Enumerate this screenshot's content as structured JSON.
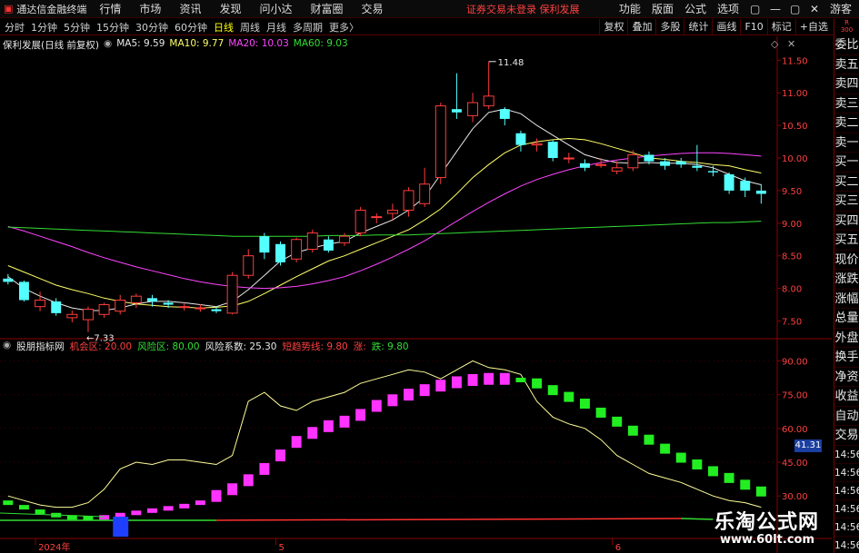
{
  "menubar": {
    "app_title": "通达信金融终端",
    "menu": [
      "行情",
      "市场",
      "资讯",
      "发现",
      "问小达",
      "财富圈",
      "交易"
    ],
    "notice": "证券交易未登录  保利发展",
    "right_menu": [
      "功能",
      "版面",
      "公式",
      "选项"
    ],
    "window_controls": [
      "▢",
      "—",
      "▢",
      "✕"
    ],
    "guest": "游客"
  },
  "periodbar": {
    "periods": [
      "分时",
      "1分钟",
      "5分钟",
      "15分钟",
      "30分钟",
      "60分钟",
      "日线",
      "周线",
      "月线",
      "多周期",
      "更多〉"
    ],
    "active": "日线",
    "tools": [
      "复权",
      "叠加",
      "多股",
      "统计",
      "画线",
      "F10",
      "标记",
      "+自选"
    ]
  },
  "main_chart": {
    "title": "保利发展(日线 前复权)",
    "ma_labels": [
      {
        "text": "MA5: 9.59",
        "color": "#e8e8e8"
      },
      {
        "text": "MA10: 9.77",
        "color": "#ffff66"
      },
      {
        "text": "MA20: 10.03",
        "color": "#ff44ff"
      },
      {
        "text": "MA60: 9.03",
        "color": "#33dd33"
      }
    ],
    "high_label": "11.48",
    "low_label": "7.33",
    "y_ticks": [
      "11.50",
      "11.00",
      "10.50",
      "10.00",
      "9.50",
      "9.00",
      "8.50",
      "8.00",
      "7.50"
    ]
  },
  "indicator": {
    "name": "股朋指标网",
    "params": [
      {
        "text": "机会区: 20.00",
        "color": "#ff4040"
      },
      {
        "text": "风险区: 80.00",
        "color": "#33dd33"
      },
      {
        "text": "风险系数: 25.30",
        "color": "#e8e8e8"
      },
      {
        "text": "短趋势线: 9.80",
        "color": "#ff4040"
      },
      {
        "text": "涨:",
        "color": "#ff4040"
      },
      {
        "text": "跌: 9.80",
        "color": "#33dd33"
      }
    ],
    "y_ticks": [
      "90.00",
      "75.00",
      "60.00",
      "45.00",
      "30.00"
    ],
    "last_value": "41.31"
  },
  "x_axis": [
    "2024年",
    "5",
    "6"
  ],
  "right_panel": {
    "top": "R\n300",
    "items": [
      "委比",
      "卖五",
      "卖四",
      "卖三",
      "卖二",
      "卖一",
      "买一",
      "买二",
      "买三",
      "买四",
      "买五",
      "现价",
      "涨跌",
      "涨幅",
      "总量",
      "外盘",
      "换手",
      "净资",
      "收益",
      "自动",
      "交易"
    ],
    "times": [
      "14:56",
      "14:56",
      "14:56",
      "14:56",
      "14:56",
      "14:56",
      "14:56"
    ]
  },
  "watermark": {
    "line1": "乐淘公式网",
    "line2": "www.60lt.com"
  },
  "chart_data": [
    {
      "type": "candlestick",
      "title": "保利发展(日线 前复权)",
      "ylim": [
        7.2,
        11.7
      ],
      "candles": [
        [
          8.15,
          8.1,
          8.22,
          8.06
        ],
        [
          8.1,
          7.82,
          8.12,
          7.8
        ],
        [
          7.72,
          7.82,
          7.95,
          7.65
        ],
        [
          7.8,
          7.62,
          7.85,
          7.58
        ],
        [
          7.55,
          7.6,
          7.66,
          7.48
        ],
        [
          7.52,
          7.68,
          7.72,
          7.33
        ],
        [
          7.6,
          7.75,
          7.78,
          7.55
        ],
        [
          7.65,
          7.82,
          7.9,
          7.6
        ],
        [
          7.78,
          7.88,
          7.92,
          7.7
        ],
        [
          7.85,
          7.8,
          7.9,
          7.72
        ],
        [
          7.78,
          7.75,
          7.82,
          7.7
        ],
        [
          7.72,
          7.72,
          7.78,
          7.66
        ],
        [
          7.7,
          7.7,
          7.76,
          7.64
        ],
        [
          7.68,
          7.65,
          7.72,
          7.62
        ],
        [
          7.62,
          8.2,
          8.25,
          7.6
        ],
        [
          8.2,
          8.5,
          8.6,
          8.15
        ],
        [
          8.8,
          8.55,
          8.85,
          8.45
        ],
        [
          8.68,
          8.4,
          8.72,
          8.35
        ],
        [
          8.45,
          8.75,
          8.78,
          8.4
        ],
        [
          8.6,
          8.85,
          8.9,
          8.55
        ],
        [
          8.75,
          8.58,
          8.8,
          8.55
        ],
        [
          8.7,
          8.8,
          8.85,
          8.65
        ],
        [
          8.85,
          9.2,
          9.25,
          8.8
        ],
        [
          9.1,
          9.1,
          9.15,
          9.0
        ],
        [
          9.15,
          9.2,
          9.3,
          9.05
        ],
        [
          9.2,
          9.5,
          9.55,
          9.1
        ],
        [
          9.3,
          9.6,
          9.85,
          9.25
        ],
        [
          9.7,
          10.8,
          10.85,
          9.6
        ],
        [
          10.75,
          10.7,
          11.3,
          10.6
        ],
        [
          10.65,
          10.85,
          11.0,
          10.55
        ],
        [
          10.8,
          10.95,
          11.48,
          10.75
        ],
        [
          10.75,
          10.6,
          10.78,
          10.5
        ],
        [
          10.38,
          10.2,
          10.42,
          10.1
        ],
        [
          10.2,
          10.22,
          10.3,
          10.1
        ],
        [
          10.25,
          10.0,
          10.28,
          9.95
        ],
        [
          10.0,
          10.0,
          10.08,
          9.92
        ],
        [
          9.92,
          9.85,
          9.98,
          9.8
        ],
        [
          9.9,
          9.9,
          10.0,
          9.85
        ],
        [
          9.8,
          9.85,
          9.95,
          9.75
        ],
        [
          9.85,
          10.05,
          10.12,
          9.8
        ],
        [
          10.05,
          9.95,
          10.1,
          9.9
        ],
        [
          9.95,
          9.88,
          10.0,
          9.82
        ],
        [
          9.95,
          9.9,
          10.0,
          9.85
        ],
        [
          9.88,
          9.85,
          10.2,
          9.8
        ],
        [
          9.8,
          9.78,
          9.88,
          9.72
        ],
        [
          9.75,
          9.5,
          9.78,
          9.45
        ],
        [
          9.65,
          9.5,
          9.7,
          9.4
        ],
        [
          9.5,
          9.45,
          9.6,
          9.3
        ]
      ],
      "series": [
        {
          "name": "MA5",
          "color": "#e8e8e8",
          "values": [
            8.18,
            8.0,
            7.88,
            7.78,
            7.7,
            7.66,
            7.66,
            7.7,
            7.76,
            7.8,
            7.8,
            7.78,
            7.75,
            7.72,
            7.8,
            7.98,
            8.2,
            8.42,
            8.55,
            8.62,
            8.68,
            8.72,
            8.85,
            8.95,
            9.05,
            9.2,
            9.4,
            9.75,
            10.1,
            10.45,
            10.7,
            10.75,
            10.68,
            10.5,
            10.35,
            10.2,
            10.05,
            9.98,
            9.93,
            9.92,
            9.93,
            9.92,
            9.92,
            9.9,
            9.85,
            9.75,
            9.65,
            9.59
          ]
        },
        {
          "name": "MA10",
          "color": "#ffff66",
          "values": [
            8.35,
            8.25,
            8.15,
            8.05,
            7.98,
            7.92,
            7.85,
            7.8,
            7.76,
            7.74,
            7.72,
            7.71,
            7.7,
            7.71,
            7.73,
            7.8,
            7.92,
            8.05,
            8.18,
            8.3,
            8.42,
            8.5,
            8.6,
            8.7,
            8.8,
            8.9,
            9.05,
            9.22,
            9.45,
            9.7,
            9.9,
            10.08,
            10.2,
            10.25,
            10.28,
            10.3,
            10.28,
            10.22,
            10.15,
            10.08,
            10.0,
            9.98,
            9.95,
            9.93,
            9.9,
            9.88,
            9.82,
            9.77
          ]
        },
        {
          "name": "MA20",
          "color": "#ff44ff",
          "values": [
            8.95,
            8.88,
            8.8,
            8.72,
            8.64,
            8.55,
            8.47,
            8.4,
            8.33,
            8.27,
            8.21,
            8.15,
            8.1,
            8.06,
            8.03,
            8.01,
            8.0,
            8.01,
            8.03,
            8.07,
            8.12,
            8.18,
            8.27,
            8.37,
            8.48,
            8.6,
            8.73,
            8.88,
            9.03,
            9.18,
            9.32,
            9.45,
            9.57,
            9.67,
            9.75,
            9.82,
            9.88,
            9.93,
            9.97,
            10.0,
            10.03,
            10.05,
            10.07,
            10.08,
            10.08,
            10.07,
            10.05,
            10.03
          ]
        },
        {
          "name": "MA60",
          "color": "#33dd33",
          "values": [
            8.94,
            8.93,
            8.92,
            8.91,
            8.9,
            8.89,
            8.88,
            8.87,
            8.86,
            8.85,
            8.84,
            8.83,
            8.82,
            8.81,
            8.8,
            8.8,
            8.8,
            8.8,
            8.8,
            8.8,
            8.81,
            8.81,
            8.81,
            8.82,
            8.82,
            8.82,
            8.83,
            8.84,
            8.85,
            8.86,
            8.87,
            8.88,
            8.89,
            8.9,
            8.91,
            8.92,
            8.93,
            8.94,
            8.95,
            8.96,
            8.97,
            8.98,
            8.99,
            9.0,
            9.01,
            9.01,
            9.02,
            9.03
          ]
        }
      ]
    },
    {
      "type": "line",
      "title": "股朋指标网",
      "ylim": [
        20,
        95
      ],
      "series": [
        {
          "name": "风险系数",
          "color": "#ffff99",
          "values": [
            30,
            28,
            26,
            25,
            25,
            27,
            33,
            42,
            45,
            44,
            46,
            46,
            45,
            44,
            48,
            72,
            76,
            70,
            68,
            72,
            74,
            76,
            80,
            82,
            84,
            86,
            85,
            82,
            86,
            90,
            87,
            86,
            84,
            72,
            65,
            62,
            60,
            55,
            48,
            44,
            40,
            38,
            36,
            33,
            30,
            28,
            27,
            25
          ]
        },
        {
          "name": "趋势",
          "color": "#ff44ff",
          "values": [
            27,
            25,
            23,
            21.5,
            20.5,
            20,
            20.5,
            21.5,
            22.5,
            23.5,
            24.5,
            25.5,
            27,
            30,
            33,
            37,
            42,
            48,
            54,
            58,
            61,
            63,
            66,
            70,
            72.5,
            75,
            77,
            79,
            80.5,
            81.5,
            82,
            82,
            81.5,
            80,
            77,
            74,
            71,
            67,
            63,
            59,
            55,
            51,
            47,
            44,
            41,
            38,
            35,
            32
          ]
        }
      ]
    }
  ]
}
